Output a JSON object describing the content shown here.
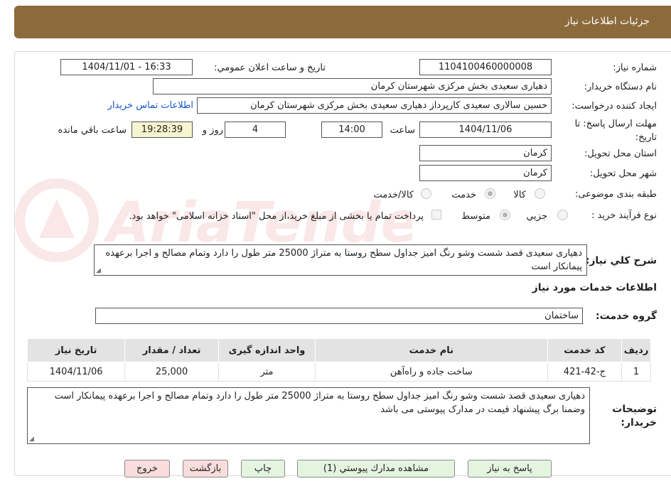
{
  "header": {
    "title": "جزئیات اطلاعات نیاز"
  },
  "form": {
    "need_number_label": "شماره نیاز:",
    "need_number": "1104100460000008",
    "announce_label": "تاریخ و ساعت اعلان عمومي:",
    "announce_value": "1404/11/01 - 16:33",
    "buyer_org_label": "نام دستگاه خریدار:",
    "buyer_org": "دهیاری سعیدی بخش مرکزی شهرستان کرمان",
    "creator_label": "ایجاد کننده درخواست:",
    "creator": "حسین سالاری سعیدی کارپرداز دهیاری سعیدی بخش مرکزی شهرستان کرمان",
    "contact_link": "اطلاعات تماس خریدار",
    "deadline_label": "مهلت ارسال پاسخ: تا تاریخ:",
    "deadline_date": "1404/11/06",
    "time_label": "ساعت",
    "deadline_time": "14:00",
    "days_value": "4",
    "days_label": "روز و",
    "remaining_time": "19:28:39",
    "remaining_label": "ساعت باقي مانده",
    "province_label": "استان محل تحویل:",
    "province": "کرمان",
    "city_label": "شهر محل تحویل:",
    "city": "کرمان",
    "category_label": "طبقه بندی موضوعی:",
    "category_options": [
      "کالا",
      "خدمت",
      "کالا/خدمت"
    ],
    "category_selected": "خدمت",
    "process_label": "نوع فرآیند خرید :",
    "process_options": [
      "جزیي",
      "متوسط"
    ],
    "process_selected": "متوسط",
    "payment_note": "پرداخت تمام یا بخشی از مبلغ خرید،از محل \"اسناد خزانه اسلامی\" خواهد بود.",
    "general_desc_label": "شرح کلي نیاز:",
    "general_desc": "دهیاری سعیدی قصد  شست وشو رنگ امیز جداول سطح روستا به متراژ 25000 متر طول را دارد  وتمام مصالح و اجرا برعهده پیمانکار است"
  },
  "services": {
    "section_title": "اطلاعات خدمات مورد نیاز",
    "group_label": "گروه خدمت:",
    "group_value": "ساختمان",
    "columns": [
      "ردیف",
      "کد خدمت",
      "نام خدمت",
      "واحد اندازه گیری",
      "تعداد / مقدار",
      "تاریخ نیاز"
    ],
    "rows": [
      {
        "row": "1",
        "code": "ج-42-421",
        "name": "ساخت جاده و راه‌آهن",
        "unit": "متر",
        "qty": "25,000",
        "date": "1404/11/06"
      }
    ]
  },
  "buyer_notes": {
    "label": "توضیحات خریدار:",
    "text": "دهیاری سعیدی قصد  شست وشو رنگ امیز جداول سطح روستا به متراژ 25000 متر طول را دارد  وتمام مصالح  و اجرا برعهده پیمانکار است وضمنا برگ پیشنهاد قیمت  در مدارک پیوستی می باشد"
  },
  "buttons": {
    "respond": "پاسخ به نیاز",
    "attachments": "مشاهده مدارك پيوستي (1)",
    "print": "چاپ",
    "back": "بازگشت",
    "exit": "خروج"
  },
  "watermark": {
    "text": "AriaTender.neT"
  },
  "colors": {
    "header": "#8c6a3c",
    "link": "#1155cc",
    "green_button": "#e4f5df",
    "pink_button": "#f9dcdc"
  }
}
